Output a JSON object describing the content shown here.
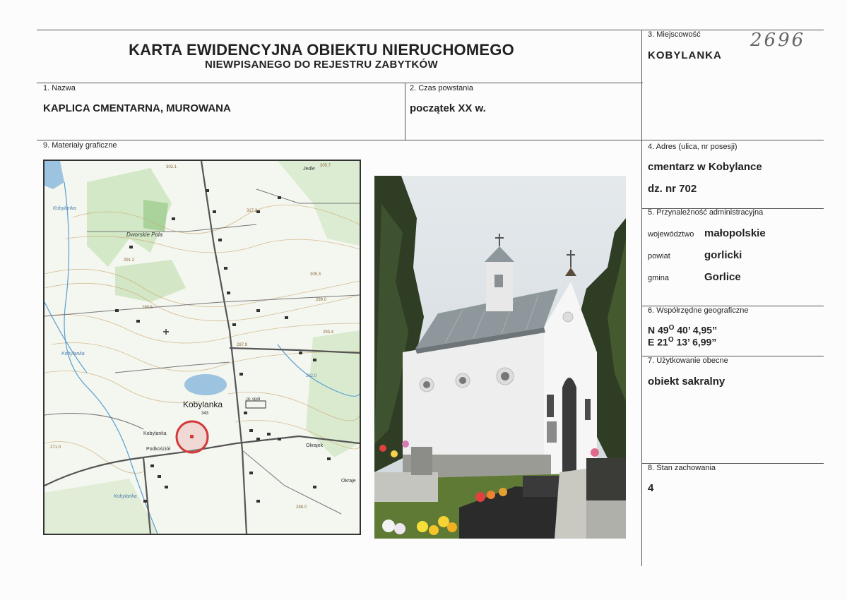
{
  "header": {
    "title": "KARTA EWIDENCYJNA OBIEKTU NIERUCHOMEGO",
    "subtitle": "NIEWPISANEGO DO REJESTRU ZABYTKÓW",
    "handwritten_number": "2696"
  },
  "fields": {
    "miejscowosc": {
      "label": "3. Miejscowość",
      "value": "KOBYLANKA"
    },
    "nazwa": {
      "label": "1. Nazwa",
      "value": "KAPLICA CMENTARNA, MUROWANA"
    },
    "czas": {
      "label": "2. Czas powstania",
      "value": "początek XX w."
    },
    "materialy": {
      "label": "9. Materiały graficzne"
    },
    "adres": {
      "label": "4. Adres (ulica, nr posesji)",
      "line1": "cmentarz w Kobylance",
      "line2": "dz. nr 702"
    },
    "przynaleznosc": {
      "label": "5. Przynależność administracyjna",
      "wojewodztwo_label": "województwo",
      "wojewodztwo": "małopolskie",
      "powiat_label": "powiat",
      "powiat": "gorlicki",
      "gmina_label": "gmina",
      "gmina": "Gorlice"
    },
    "wspolrzedne": {
      "label": "6. Współrzędne geograficzne",
      "n_prefix": "N 49",
      "n_deg": "O",
      "n_rest": " 40’ 4,95”",
      "e_prefix": "E 21",
      "e_deg": "O",
      "e_rest": " 13’ 6,99”"
    },
    "uzytkowanie": {
      "label": "7. Użytkowanie obecne",
      "value": "obiekt sakralny"
    },
    "stan": {
      "label": "8. Stan zachowania",
      "value": "4"
    }
  },
  "map": {
    "town_label": "Kobylanka",
    "town_height": "343",
    "places": [
      "Kobylanka",
      "Dworskie Pola",
      "Jedle",
      "Okrajek",
      "Podkościół",
      "Kobylanka",
      "Kobylanka",
      "Kobylanka",
      "Okraje",
      "pl. spół"
    ],
    "heights": [
      "302.1",
      "305.7",
      "317.2",
      "291.2",
      "305.3",
      "290.5",
      "299.0",
      "293.4",
      "287.9",
      "282.0",
      "271.0",
      "288.0"
    ],
    "colors": {
      "road": "#555555",
      "water": "#9cc3e0",
      "forest": "#bfe0b0",
      "contour": "#c9a46a",
      "marker": "#d23a3a"
    }
  },
  "photo": {
    "colors": {
      "sky": "#d8dfe4",
      "wall": "#f2f2f2",
      "roof": "#8e979b",
      "tree": "#2f3d25",
      "grass": "#5f7a34"
    }
  }
}
